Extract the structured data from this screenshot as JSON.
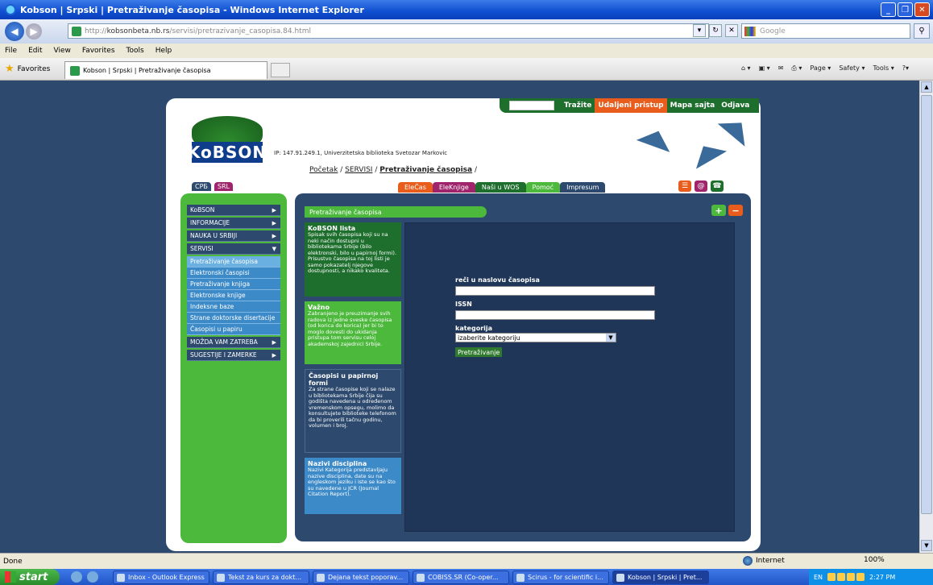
{
  "window": {
    "title": "Kobson | Srpski | Pretraživanje časopisa - Windows Internet Explorer"
  },
  "address": {
    "url_prefix": "http://",
    "url_host": "kobsonbeta.nb.rs",
    "url_path": "/servisi/pretrazivanje_casopisa.84.html",
    "search_placeholder": "Google"
  },
  "menu": [
    "File",
    "Edit",
    "View",
    "Favorites",
    "Tools",
    "Help"
  ],
  "favorites": {
    "label": "Favorites",
    "tab_title": "Kobson | Srpski | Pretraživanje časopisa"
  },
  "toolbar_right": [
    "Page ▾",
    "Safety ▾",
    "Tools ▾"
  ],
  "site": {
    "topnav": {
      "search_button": "Tražite",
      "remote": "Udaljeni pristup",
      "sitemap": "Mapa sajta",
      "logout": "Odjava"
    },
    "logo_text": "KoBSON",
    "ip_line": "IP: 147.91.249.1, Univerzitetska biblioteka Svetozar Markovic",
    "breadcrumb": {
      "home": "Početak",
      "services": "SERVISI",
      "current": "Pretraživanje časopisa",
      "sep": " / "
    },
    "lang": {
      "cyr": "CPБ",
      "lat": "SRL"
    },
    "tabs": [
      "EleČas",
      "EleKnjige",
      "Naši u WOS",
      "Pomoć",
      "Impresum"
    ],
    "sidebar": {
      "items": [
        "KoBSON",
        "INFORMACIJE",
        "NAUKA U SRBIJI",
        "SERVISI"
      ],
      "subitems": [
        "Pretraživanje časopisa",
        "Elektronski časopisi",
        "Pretraživanje knjiga",
        "Elektronske knjige",
        "Indeksne baze",
        "Strane doktorske disertacije",
        "Časopisi u papiru"
      ],
      "items2": [
        "MOŽDA VAM ZATREBA",
        "SUGESTIJE I ZAMERKE"
      ]
    },
    "main": {
      "title": "Pretraživanje časopisa",
      "plus": "+",
      "minus": "−",
      "panels": [
        {
          "heading": "KoBSON lista",
          "text": "Spisak svih časopisa koji su na neki način dostupni u bibliotekama Srbije (bilo elektronski, bilo u papirnoj formi). Prisustvo časopisa na toj listi je samo pokazatelj njegove dostupnosti, a nikako kvaliteta."
        },
        {
          "heading": "Važno",
          "text": "Zabranjeno je preuzimanje svih radova iz jedne sveske časopisa (od korica do korica) jer bi to moglo dovesti do ukidanja pristupa tom servisu celoj akademskoj zajednici Srbije."
        },
        {
          "heading": "Časopisi u papirnoj formi",
          "text": "Za strane časopise koji se nalaze u bibliotekama Srbije čija su godišta navedena u određenom vremenskom opsegu, molimo da konsultujete biblioteke telefonom da bi proverili tačnu godinu, volumen i broj."
        },
        {
          "heading": "Nazivi disciplina",
          "text": "Nazivi Kategorija predstavljaju nazive disciplina, date su na engleskom jeziku i iste se kao što su navedene u JCR (Journal Citation Report)."
        }
      ],
      "form": {
        "title_label": "reči u naslovu časopisa",
        "issn_label": "ISSN",
        "category_label": "kategorija",
        "category_selected": "izaberite kategoriju",
        "submit": "Pretraživanje"
      }
    }
  },
  "status": {
    "text": "Done",
    "zone": "Internet",
    "zoom": "100%"
  },
  "taskbar": {
    "start": "start",
    "items": [
      "Inbox - Outlook Express",
      "Tekst za kurs za dokt...",
      "Dejana tekst poporav...",
      "COBISS.SR (Co-oper...",
      "Scirus - for scientific i...",
      "Kobson | Srpski | Pret..."
    ],
    "lang": "EN",
    "clock": "2:27 PM"
  },
  "colors": {
    "green": "#4cb83c",
    "navy": "#2d4a6e",
    "orange": "#e85c1c",
    "darkgreen": "#1e6e2e",
    "blue": "#3d8ac8"
  }
}
